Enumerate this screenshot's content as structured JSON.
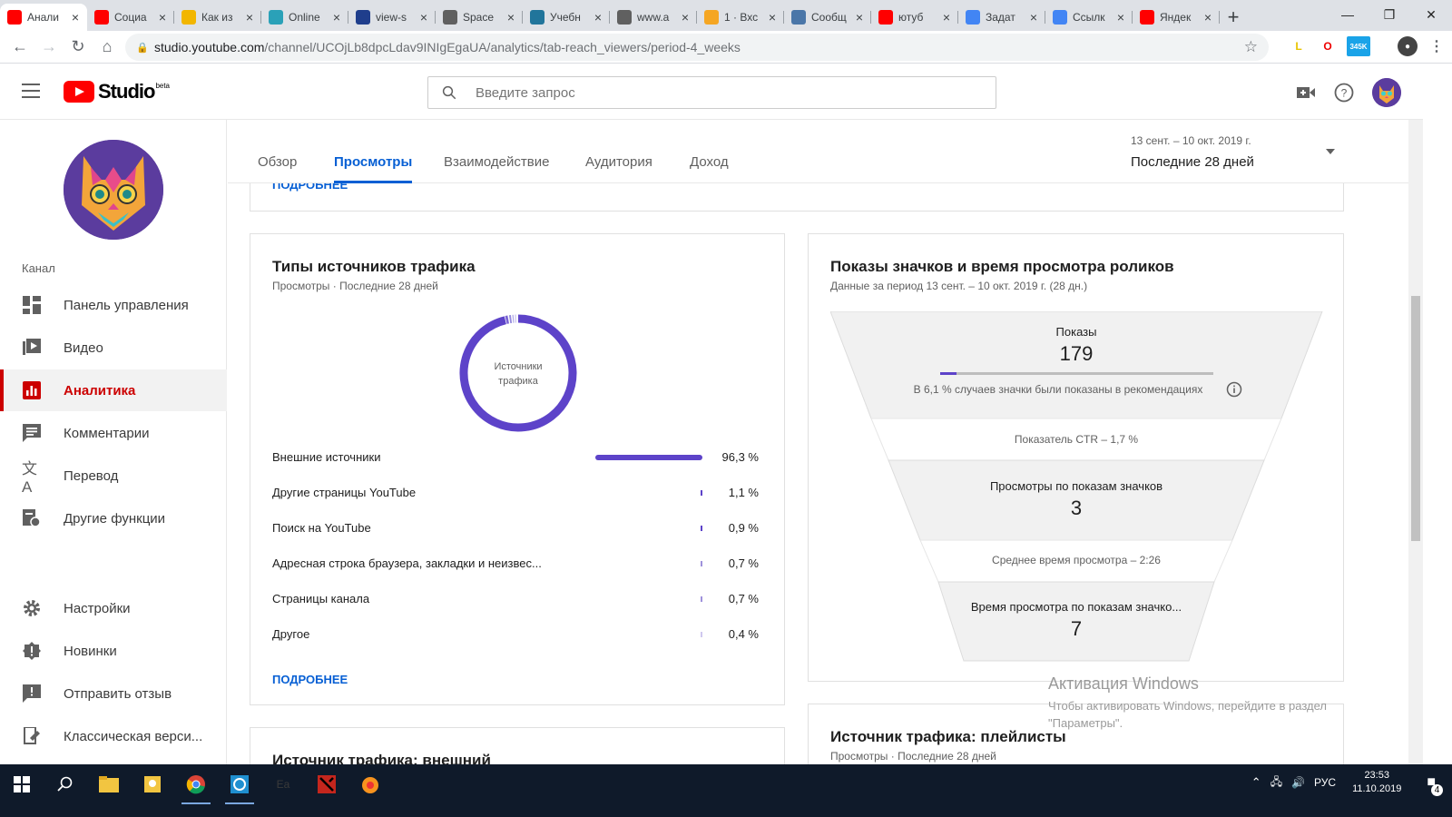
{
  "browser": {
    "tabs": [
      {
        "title": "Анали",
        "icon": "youtube-icon",
        "color": "#ff0000"
      },
      {
        "title": "Социа",
        "icon": "youtube-icon",
        "color": "#ff0000"
      },
      {
        "title": "Как из",
        "icon": "fs-icon",
        "color": "#f2b600"
      },
      {
        "title": "Online",
        "icon": "cloud-icon",
        "color": "#2aa1b8"
      },
      {
        "title": "view-s",
        "icon": "circle-icon",
        "color": "#1f3e8c"
      },
      {
        "title": "Space",
        "icon": "globe-icon",
        "color": "#606060"
      },
      {
        "title": "Учебн",
        "icon": "wordpress-icon",
        "color": "#21759b"
      },
      {
        "title": "www.a",
        "icon": "globe-icon",
        "color": "#606060"
      },
      {
        "title": "1 · Вхс",
        "icon": "mail-icon",
        "color": "#f5a623"
      },
      {
        "title": "Сообщ",
        "icon": "vk-icon",
        "color": "#4a76a8"
      },
      {
        "title": "ютуб",
        "icon": "yandex-icon",
        "color": "#ff0000"
      },
      {
        "title": "Задат",
        "icon": "google-icon",
        "color": "#4285f4"
      },
      {
        "title": "Ссылк",
        "icon": "google-icon",
        "color": "#4285f4"
      },
      {
        "title": "Яндек",
        "icon": "yandex-icon",
        "color": "#ff0000"
      }
    ],
    "url_host": "studio.youtube.com",
    "url_path": "/channel/UCOjLb8dpcLdav9INIgEgaUA/analytics/tab-reach_viewers/period-4_weeks",
    "ext_badge": "345K"
  },
  "studio": {
    "search_placeholder": "Введите запрос",
    "logo_text": "Studio",
    "logo_badge": "beta"
  },
  "sidebar": {
    "section_label": "Канал",
    "items": [
      {
        "label": "Панель управления",
        "icon": "dashboard-icon"
      },
      {
        "label": "Видео",
        "icon": "video-icon"
      },
      {
        "label": "Аналитика",
        "icon": "analytics-icon"
      },
      {
        "label": "Комментарии",
        "icon": "comments-icon"
      },
      {
        "label": "Перевод",
        "icon": "translate-icon"
      },
      {
        "label": "Другие функции",
        "icon": "features-icon"
      }
    ],
    "bottom_items": [
      {
        "label": "Настройки",
        "icon": "settings-icon"
      },
      {
        "label": "Новинки",
        "icon": "whats-new-icon"
      },
      {
        "label": "Отправить отзыв",
        "icon": "feedback-icon"
      },
      {
        "label": "Классическая верси...",
        "icon": "classic-icon"
      }
    ]
  },
  "analytics": {
    "tabs": [
      "Обзор",
      "Просмотры",
      "Взаимодействие",
      "Аудитория",
      "Доход"
    ],
    "active_tab": "Просмотры",
    "period_range": "13 сент. – 10 окт. 2019 г.",
    "period_label": "Последние 28 дней",
    "top_more": "ПОДРОБНЕЕ"
  },
  "traffic_card": {
    "title": "Типы источников трафика",
    "subtitle": "Просмотры · Последние 28 дней",
    "donut_center": "Источники трафика",
    "rows": [
      {
        "label": "Внешние источники",
        "value": "96,3 %"
      },
      {
        "label": "Другие страницы YouTube",
        "value": "1,1 %"
      },
      {
        "label": "Поиск на YouTube",
        "value": "0,9 %"
      },
      {
        "label": "Адресная строка браузера, закладки и неизвес...",
        "value": "0,7 %"
      },
      {
        "label": "Страницы канала",
        "value": "0,7 %"
      },
      {
        "label": "Другое",
        "value": "0,4 %"
      }
    ],
    "more": "ПОДРОБНЕЕ"
  },
  "funnel_card": {
    "title": "Показы значков и время просмотра роликов",
    "subtitle": "Данные за период 13 сент. – 10 окт. 2019 г. (28 дн.)",
    "impressions_label": "Показы",
    "impressions_value": "179",
    "recommend_note": "В 6,1 % случаев значки были показаны в рекомендациях",
    "ctr": "Показатель CTR – 1,7 %",
    "views_label": "Просмотры по показам значков",
    "views_value": "3",
    "avg_time": "Среднее время просмотра – 2:26",
    "watch_label": "Время просмотра по показам значко...",
    "watch_value": "7"
  },
  "external_card": {
    "title": "Источник трафика: внешний"
  },
  "playlists_card": {
    "title": "Источник трафика: плейлисты",
    "subtitle": "Просмотры · Последние 28 дней"
  },
  "chart_data": {
    "type": "pie",
    "categories": [
      "Внешние источники",
      "Другие страницы YouTube",
      "Поиск на YouTube",
      "Адресная строка браузера, закладки и неизвес...",
      "Страницы канала",
      "Другое"
    ],
    "values": [
      96.3,
      1.1,
      0.9,
      0.7,
      0.7,
      0.4
    ],
    "recommend_fraction": 0.061
  },
  "watermark": {
    "line1": "Активация Windows",
    "line2": "Чтобы активировать Windows, перейдите в раздел",
    "line3": "\"Параметры\"."
  },
  "taskbar": {
    "lang": "РУС",
    "time": "23:53",
    "date": "11.10.2019",
    "notif_count": "4"
  },
  "colors": {
    "accent": "#065fd4",
    "brand": "#ff0000",
    "chart": "#5d43c9",
    "active_nav": "#cc0000"
  }
}
